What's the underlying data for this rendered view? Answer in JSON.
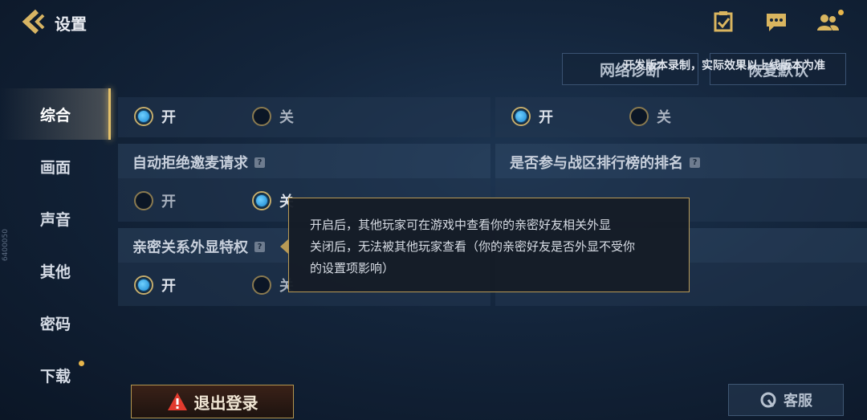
{
  "header": {
    "title": "设置"
  },
  "top_buttons": {
    "network": "网络诊断",
    "reset": "恢复默认"
  },
  "dev_note": "开发版本录制，实际效果以上线版本为准",
  "sidebar": {
    "items": [
      {
        "label": "综合",
        "active": true
      },
      {
        "label": "画面"
      },
      {
        "label": "声音"
      },
      {
        "label": "其他"
      },
      {
        "label": "密码"
      },
      {
        "label": "下载"
      }
    ],
    "code": "6400050"
  },
  "options": {
    "on": "开",
    "off": "关"
  },
  "sections": {
    "reject_mic": "自动拒绝邀麦请求",
    "ranking": "是否参与战区排行榜的排名",
    "intimacy": "亲密关系外显特权"
  },
  "tooltip": {
    "line1": "开启后，其他玩家可在游戏中查看你的亲密好友相关外显",
    "line2": "关闭后，无法被其他玩家查看（你的亲密好友是否外显不受你",
    "line3": "的设置项影响）"
  },
  "bottom": {
    "logout": "退出登录",
    "service": "客服"
  },
  "colors": {
    "accent_gold": "#e3c06a",
    "radio_blue": "#37a9f0",
    "warning_red": "#e23b2e"
  }
}
